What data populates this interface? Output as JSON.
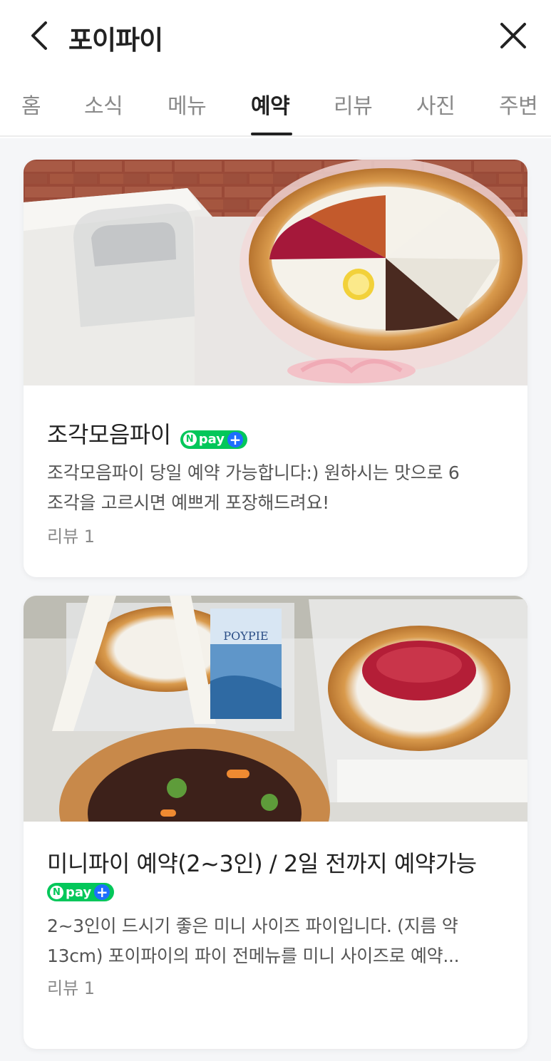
{
  "header": {
    "title": "포이파이"
  },
  "tabs": [
    {
      "label": "홈",
      "active": false
    },
    {
      "label": "소식",
      "active": false
    },
    {
      "label": "메뉴",
      "active": false
    },
    {
      "label": "예약",
      "active": true
    },
    {
      "label": "리뷰",
      "active": false
    },
    {
      "label": "사진",
      "active": false
    },
    {
      "label": "주변",
      "active": false
    }
  ],
  "products": [
    {
      "title": "조각모음파이",
      "badge": "pay",
      "desc_line1": "조각모음파이 당일 예약 가능합니다:) 원하시는 맛으로 6",
      "desc_line2": "조각을 고르시면 예쁘게 포장해드려요!",
      "review": "리뷰 1"
    },
    {
      "title": "미니파이 예약(2~3인) / 2일 전까지 예약가능",
      "badge": "pay",
      "desc_line1": "2~3인이 드시기 좋은 미니 사이즈 파이입니다. (지름 약",
      "desc_line2": "13cm) 포이파이의 파이 전메뉴를 미니 사이즈로 예약...",
      "review": "리뷰 1",
      "box_label": "POYPIE"
    }
  ],
  "colors": {
    "npay_green": "#03c75a",
    "npay_blue": "#1e6fff",
    "list_bg": "#f5f6f8"
  }
}
